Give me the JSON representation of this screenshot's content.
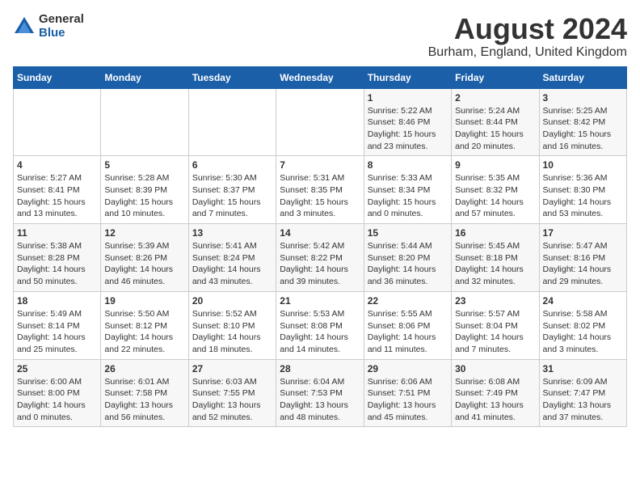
{
  "logo": {
    "general": "General",
    "blue": "Blue"
  },
  "title": "August 2024",
  "location": "Burham, England, United Kingdom",
  "days_of_week": [
    "Sunday",
    "Monday",
    "Tuesday",
    "Wednesday",
    "Thursday",
    "Friday",
    "Saturday"
  ],
  "weeks": [
    [
      {
        "day": "",
        "detail": ""
      },
      {
        "day": "",
        "detail": ""
      },
      {
        "day": "",
        "detail": ""
      },
      {
        "day": "",
        "detail": ""
      },
      {
        "day": "1",
        "detail": "Sunrise: 5:22 AM\nSunset: 8:46 PM\nDaylight: 15 hours\nand 23 minutes."
      },
      {
        "day": "2",
        "detail": "Sunrise: 5:24 AM\nSunset: 8:44 PM\nDaylight: 15 hours\nand 20 minutes."
      },
      {
        "day": "3",
        "detail": "Sunrise: 5:25 AM\nSunset: 8:42 PM\nDaylight: 15 hours\nand 16 minutes."
      }
    ],
    [
      {
        "day": "4",
        "detail": "Sunrise: 5:27 AM\nSunset: 8:41 PM\nDaylight: 15 hours\nand 13 minutes."
      },
      {
        "day": "5",
        "detail": "Sunrise: 5:28 AM\nSunset: 8:39 PM\nDaylight: 15 hours\nand 10 minutes."
      },
      {
        "day": "6",
        "detail": "Sunrise: 5:30 AM\nSunset: 8:37 PM\nDaylight: 15 hours\nand 7 minutes."
      },
      {
        "day": "7",
        "detail": "Sunrise: 5:31 AM\nSunset: 8:35 PM\nDaylight: 15 hours\nand 3 minutes."
      },
      {
        "day": "8",
        "detail": "Sunrise: 5:33 AM\nSunset: 8:34 PM\nDaylight: 15 hours\nand 0 minutes."
      },
      {
        "day": "9",
        "detail": "Sunrise: 5:35 AM\nSunset: 8:32 PM\nDaylight: 14 hours\nand 57 minutes."
      },
      {
        "day": "10",
        "detail": "Sunrise: 5:36 AM\nSunset: 8:30 PM\nDaylight: 14 hours\nand 53 minutes."
      }
    ],
    [
      {
        "day": "11",
        "detail": "Sunrise: 5:38 AM\nSunset: 8:28 PM\nDaylight: 14 hours\nand 50 minutes."
      },
      {
        "day": "12",
        "detail": "Sunrise: 5:39 AM\nSunset: 8:26 PM\nDaylight: 14 hours\nand 46 minutes."
      },
      {
        "day": "13",
        "detail": "Sunrise: 5:41 AM\nSunset: 8:24 PM\nDaylight: 14 hours\nand 43 minutes."
      },
      {
        "day": "14",
        "detail": "Sunrise: 5:42 AM\nSunset: 8:22 PM\nDaylight: 14 hours\nand 39 minutes."
      },
      {
        "day": "15",
        "detail": "Sunrise: 5:44 AM\nSunset: 8:20 PM\nDaylight: 14 hours\nand 36 minutes."
      },
      {
        "day": "16",
        "detail": "Sunrise: 5:45 AM\nSunset: 8:18 PM\nDaylight: 14 hours\nand 32 minutes."
      },
      {
        "day": "17",
        "detail": "Sunrise: 5:47 AM\nSunset: 8:16 PM\nDaylight: 14 hours\nand 29 minutes."
      }
    ],
    [
      {
        "day": "18",
        "detail": "Sunrise: 5:49 AM\nSunset: 8:14 PM\nDaylight: 14 hours\nand 25 minutes."
      },
      {
        "day": "19",
        "detail": "Sunrise: 5:50 AM\nSunset: 8:12 PM\nDaylight: 14 hours\nand 22 minutes."
      },
      {
        "day": "20",
        "detail": "Sunrise: 5:52 AM\nSunset: 8:10 PM\nDaylight: 14 hours\nand 18 minutes."
      },
      {
        "day": "21",
        "detail": "Sunrise: 5:53 AM\nSunset: 8:08 PM\nDaylight: 14 hours\nand 14 minutes."
      },
      {
        "day": "22",
        "detail": "Sunrise: 5:55 AM\nSunset: 8:06 PM\nDaylight: 14 hours\nand 11 minutes."
      },
      {
        "day": "23",
        "detail": "Sunrise: 5:57 AM\nSunset: 8:04 PM\nDaylight: 14 hours\nand 7 minutes."
      },
      {
        "day": "24",
        "detail": "Sunrise: 5:58 AM\nSunset: 8:02 PM\nDaylight: 14 hours\nand 3 minutes."
      }
    ],
    [
      {
        "day": "25",
        "detail": "Sunrise: 6:00 AM\nSunset: 8:00 PM\nDaylight: 14 hours\nand 0 minutes."
      },
      {
        "day": "26",
        "detail": "Sunrise: 6:01 AM\nSunset: 7:58 PM\nDaylight: 13 hours\nand 56 minutes."
      },
      {
        "day": "27",
        "detail": "Sunrise: 6:03 AM\nSunset: 7:55 PM\nDaylight: 13 hours\nand 52 minutes."
      },
      {
        "day": "28",
        "detail": "Sunrise: 6:04 AM\nSunset: 7:53 PM\nDaylight: 13 hours\nand 48 minutes."
      },
      {
        "day": "29",
        "detail": "Sunrise: 6:06 AM\nSunset: 7:51 PM\nDaylight: 13 hours\nand 45 minutes."
      },
      {
        "day": "30",
        "detail": "Sunrise: 6:08 AM\nSunset: 7:49 PM\nDaylight: 13 hours\nand 41 minutes."
      },
      {
        "day": "31",
        "detail": "Sunrise: 6:09 AM\nSunset: 7:47 PM\nDaylight: 13 hours\nand 37 minutes."
      }
    ]
  ]
}
